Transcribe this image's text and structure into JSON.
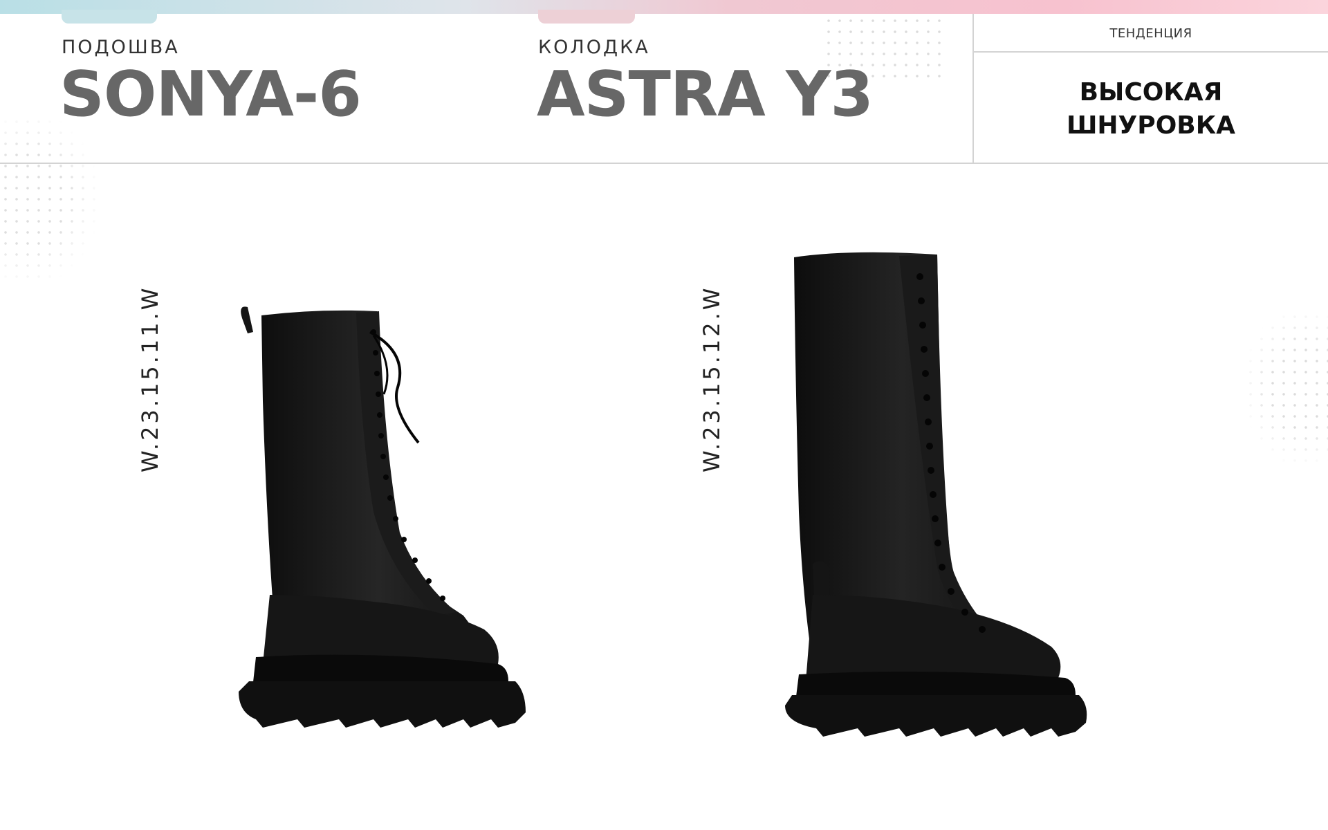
{
  "header": {
    "sole_label": "ПОДОШВА",
    "sole_name": "SONYA-6",
    "last_label": "КОЛОДКА",
    "last_name": "ASTRA Y3",
    "trend_label": "ТЕНДЕНЦИЯ",
    "trend_value_line1": "ВЫСОКАЯ",
    "trend_value_line2": "ШНУРОВКА"
  },
  "products": [
    {
      "sku": "W.23.15.11.W",
      "image": "black-lace-up-knee-boot-icon"
    },
    {
      "sku": "W.23.15.12.W",
      "image": "black-lace-up-knee-boot-icon"
    }
  ],
  "colors": {
    "heading_gray": "#676767",
    "divider": "#d3d3d3",
    "boot": "#1a1a1a"
  }
}
